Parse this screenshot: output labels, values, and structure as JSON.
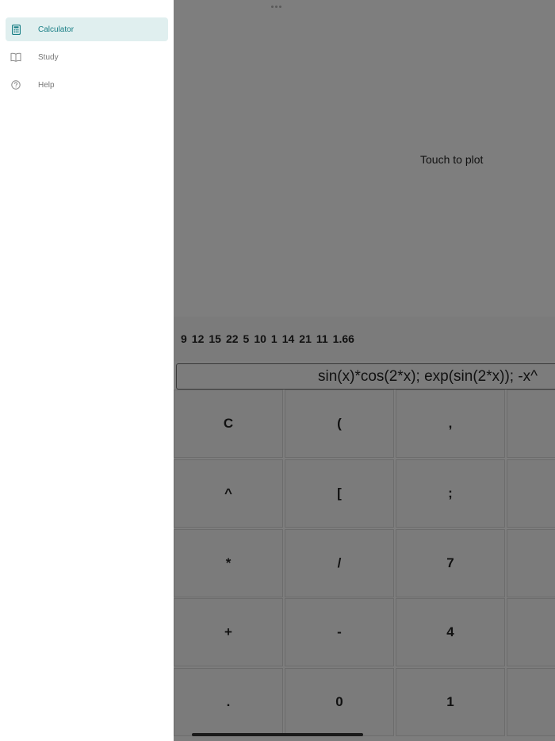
{
  "sidebar": {
    "items": [
      {
        "label": "Calculator",
        "icon": "calculator-icon",
        "active": true
      },
      {
        "label": "Study",
        "icon": "book-icon",
        "active": false
      },
      {
        "label": "Help",
        "icon": "question-circle-icon",
        "active": false
      }
    ]
  },
  "plot": {
    "hint": "Touch to plot"
  },
  "numbers": [
    "9",
    "12",
    "15",
    "22",
    "5",
    "10",
    "1",
    "14",
    "21",
    "11",
    "1.66"
  ],
  "input": {
    "value": "sin(x)*cos(2*x); exp(sin(2*x)); -x^"
  },
  "keypad": {
    "rows": [
      [
        "C",
        "(",
        ","
      ],
      [
        "^",
        "[",
        ";"
      ],
      [
        "*",
        "/",
        "7"
      ],
      [
        "+",
        "-",
        "4"
      ],
      [
        ".",
        "0",
        "1"
      ]
    ]
  },
  "colors": {
    "accent": "#1a7f86",
    "active_bg": "#e0efef",
    "main_bg": "#7d7d7d"
  }
}
